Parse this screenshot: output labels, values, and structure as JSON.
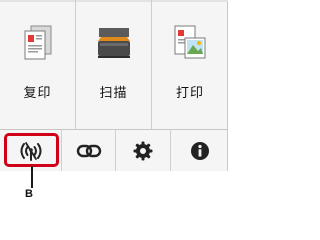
{
  "tiles": [
    {
      "label": "复印",
      "icon": "copy-icon"
    },
    {
      "label": "扫描",
      "icon": "scan-icon"
    },
    {
      "label": "打印",
      "icon": "print-photo-icon"
    }
  ],
  "bottom_buttons": [
    {
      "icon": "wireless-icon",
      "highlighted": true
    },
    {
      "icon": "link-icon"
    },
    {
      "icon": "gear-icon"
    },
    {
      "icon": "info-icon"
    }
  ],
  "callout": {
    "label": "B"
  },
  "colors": {
    "highlight": "#cf0017",
    "panel_bg": "#f5f5f5"
  }
}
